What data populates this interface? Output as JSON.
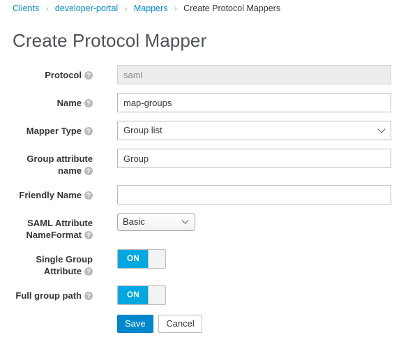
{
  "breadcrumb": {
    "separator": "›",
    "items": [
      {
        "label": "Clients",
        "link": true
      },
      {
        "label": "developer-portal",
        "link": true
      },
      {
        "label": "Mappers",
        "link": true
      },
      {
        "label": "Create Protocol Mappers",
        "link": false
      }
    ]
  },
  "page": {
    "title": "Create Protocol Mapper"
  },
  "help_icon_glyph": "?",
  "form": {
    "protocol": {
      "label": "Protocol",
      "value": "saml",
      "placeholder": "",
      "disabled": true
    },
    "name": {
      "label": "Name",
      "value": "map-groups",
      "placeholder": ""
    },
    "mapper_type": {
      "label": "Mapper Type",
      "value": "Group list"
    },
    "group_attribute_name": {
      "label_line1": "Group attribute",
      "label_line2": "name",
      "value": "Group",
      "placeholder": ""
    },
    "friendly_name": {
      "label": "Friendly Name",
      "value": "",
      "placeholder": ""
    },
    "saml_attribute_nameformat": {
      "label_line1": "SAML Attribute",
      "label_line2": "NameFormat",
      "value": "Basic"
    },
    "single_group_attribute": {
      "label_line1": "Single Group",
      "label_line2": "Attribute",
      "state": "ON"
    },
    "full_group_path": {
      "label": "Full group path",
      "state": "ON"
    }
  },
  "actions": {
    "save_label": "Save",
    "cancel_label": "Cancel"
  },
  "colors": {
    "link": "#0088ce",
    "primary_button": "#0088ce",
    "toggle_on": "#00a8e1",
    "text": "#363636",
    "title": "#4d5258",
    "disabled_bg": "#ededed"
  }
}
